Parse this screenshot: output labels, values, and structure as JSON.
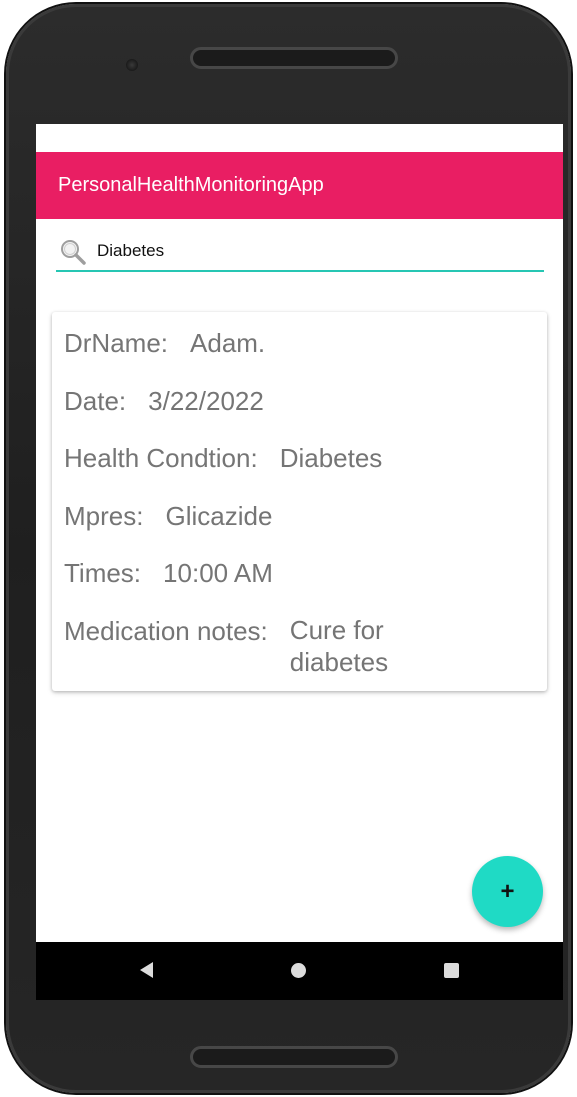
{
  "app": {
    "title": "PersonalHealthMonitoringApp"
  },
  "search": {
    "value": "Diabetes",
    "icon": "search-icon"
  },
  "record": {
    "doctor_label": "DrName:",
    "doctor_value": "Adam.",
    "date_label": "Date:",
    "date_value": "3/22/2022",
    "condition_label": "Health Condtion:",
    "condition_value": "Diabetes",
    "mpres_label": "Mpres:",
    "mpres_value": "Glicazide",
    "times_label": "Times:",
    "times_value": "10:00 AM",
    "notes_label": "Medication notes:",
    "notes_value": "Cure for diabetes"
  },
  "fab": {
    "label": "+"
  },
  "colors": {
    "app_bar": "#e91e63",
    "accent": "#1fdac5",
    "search_underline": "#26c6b3",
    "text_secondary": "#757575"
  },
  "nav": {
    "icons": [
      "back-icon",
      "home-icon",
      "recent-apps-icon"
    ]
  }
}
